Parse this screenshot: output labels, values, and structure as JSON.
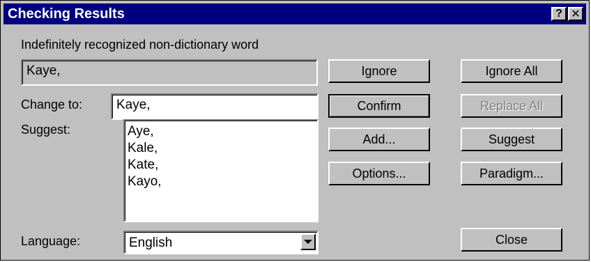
{
  "window": {
    "title": "Checking Results",
    "help_label": "?",
    "close_label": "✕"
  },
  "status": {
    "label": "Indefinitely recognized non-dictionary word",
    "word": "Kaye,"
  },
  "change_to": {
    "label": "Change to:",
    "value": "Kaye,"
  },
  "suggest": {
    "label": "Suggest:",
    "items": [
      "Aye,",
      "Kale,",
      "Kate,",
      "Kayo,"
    ]
  },
  "language": {
    "label": "Language:",
    "selected": "English"
  },
  "buttons": {
    "ignore": "Ignore",
    "ignore_all": "Ignore All",
    "confirm": "Confirm",
    "replace_all": "Replace All",
    "add": "Add...",
    "suggest": "Suggest",
    "options": "Options...",
    "paradigm": "Paradigm...",
    "close": "Close"
  }
}
